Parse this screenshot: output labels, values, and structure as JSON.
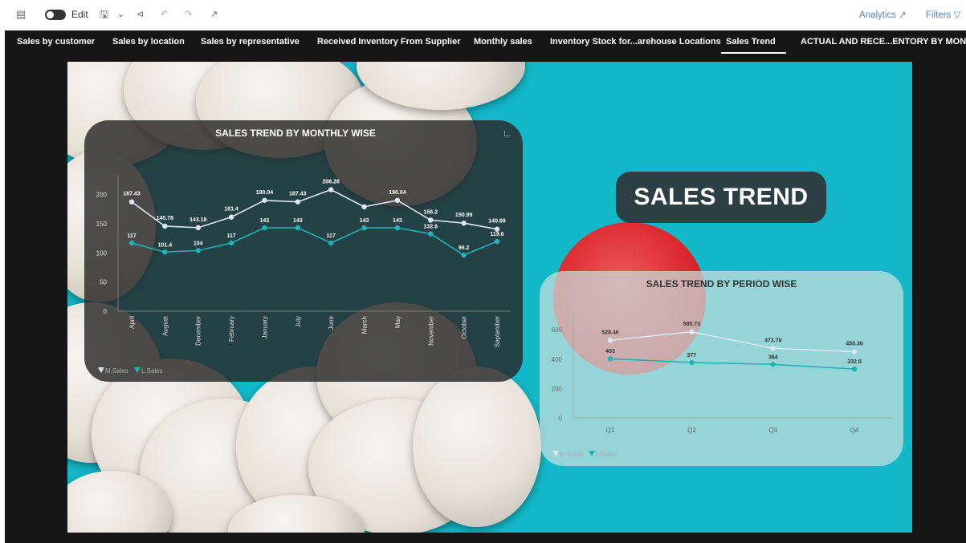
{
  "toolbar": {
    "edit_label": "Edit",
    "analytics_label": "Analytics",
    "filters_label": "Filters"
  },
  "tabs": [
    {
      "label": "Sales by customer"
    },
    {
      "label": "Sales by location"
    },
    {
      "label": "Sales by representative"
    },
    {
      "label": "Received Inventory From Supplier"
    },
    {
      "label": "Monthly sales"
    },
    {
      "label": "Inventory Stock for...arehouse Locations"
    },
    {
      "label": "Sales Trend"
    },
    {
      "label": "ACTUAL AND RECE...ENTORY BY MONTH"
    }
  ],
  "active_tab": "Sales Trend",
  "badge_text": "SALES TREND",
  "colors": {
    "m_sales": "#dde6f5",
    "l_sales": "#1fb3b8",
    "tab_bar": "#161616",
    "report_bg": "#13b8c8"
  },
  "chart_data": [
    {
      "type": "line",
      "title": "SALES TREND BY MONTHLY WISE",
      "categories": [
        "April",
        "August",
        "December",
        "February",
        "January",
        "July",
        "June",
        "March",
        "May",
        "November",
        "October",
        "September"
      ],
      "series": [
        {
          "name": "M.Sales",
          "values": [
            187.43,
            145.78,
            143.18,
            161.4,
            190.04,
            187.43,
            208.26,
            179,
            190.04,
            156.2,
            150.99,
            140.68
          ]
        },
        {
          "name": "L.Sales",
          "values": [
            117,
            101.4,
            104,
            117,
            143,
            143,
            117,
            143,
            143,
            132.6,
            96.2,
            119.6
          ]
        }
      ],
      "data_labels": {
        "M.Sales": [
          "187.43",
          "145.78",
          "143.18",
          "161.4",
          "190.04",
          "187.43",
          "208.26",
          "",
          "190.04",
          "156.2",
          "150.99",
          "140.68"
        ],
        "L.Sales": [
          "117",
          "101.4",
          "104",
          "117",
          "143",
          "143",
          "117",
          "143",
          "143",
          "132.6",
          "96.2",
          "119.6"
        ]
      },
      "yticks": [
        "0",
        "50",
        "100",
        "150",
        "200"
      ],
      "ylim": [
        0,
        220
      ],
      "legend": [
        "M.Sales",
        "L.Sales"
      ],
      "legend_position": "bottom-left"
    },
    {
      "type": "line",
      "title": "SALES TREND BY PERIOD WISE",
      "categories": [
        "Q1",
        "Q2",
        "Q3",
        "Q4"
      ],
      "series": [
        {
          "name": "M.Sales",
          "values": [
            528.46,
            585.73,
            473.79,
            450.36
          ]
        },
        {
          "name": "L.Sales",
          "values": [
            403,
            377,
            364,
            332.8
          ]
        }
      ],
      "data_labels": {
        "M.Sales": [
          "528.46",
          "585.73",
          "473.79",
          "450.36"
        ],
        "L.Sales": [
          "403",
          "377",
          "364",
          "332.8"
        ]
      },
      "yticks": [
        "0",
        "200",
        "400",
        "600"
      ],
      "ylim": [
        0,
        650
      ],
      "legend": [
        "M.Sales",
        "L.Sales"
      ],
      "legend_position": "bottom-left"
    }
  ]
}
